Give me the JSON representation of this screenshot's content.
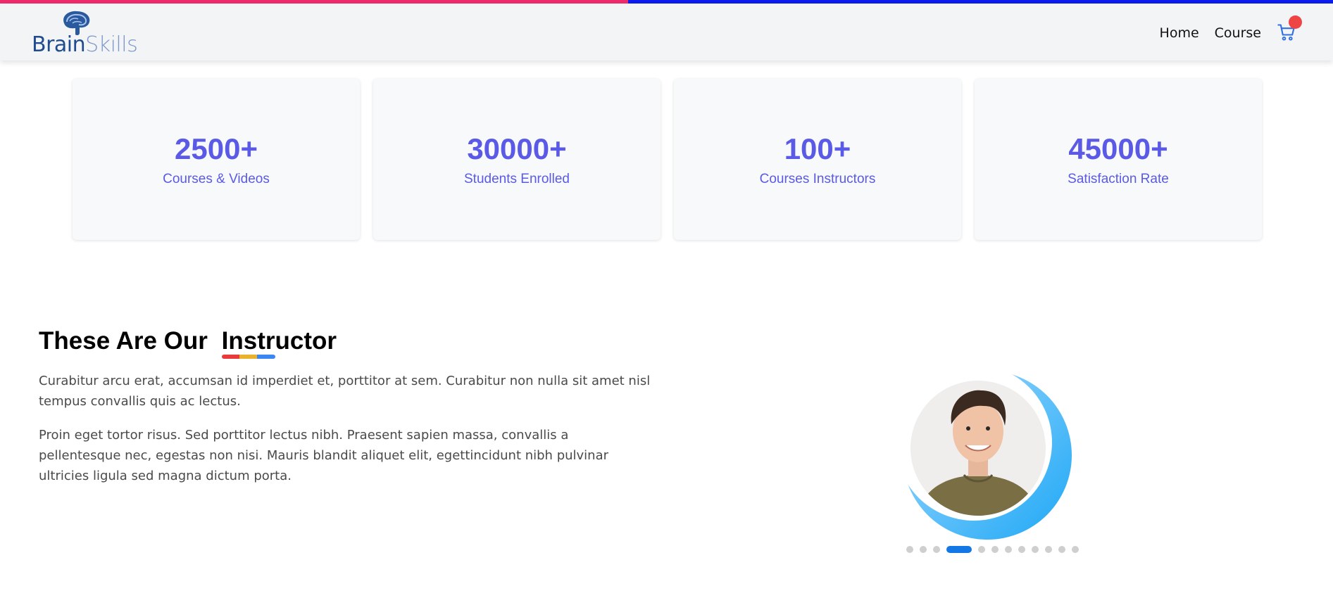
{
  "brand": {
    "name_part1": "Brain",
    "name_part2": "Skills"
  },
  "nav": {
    "items": [
      {
        "label": "Home"
      },
      {
        "label": "Course"
      }
    ]
  },
  "stats": [
    {
      "value": "2500+",
      "label": "Courses & Videos"
    },
    {
      "value": "30000+",
      "label": "Students Enrolled"
    },
    {
      "value": "100+",
      "label": "Courses Instructors"
    },
    {
      "value": "45000+",
      "label": "Satisfaction Rate"
    }
  ],
  "instructor": {
    "title_prefix": "These Are Our",
    "title_accent": "Instructor",
    "paragraph1": "Curabitur arcu erat, accumsan id imperdiet et, porttitor at sem. Curabitur non nulla sit amet nisl tempus convallis quis ac lectus.",
    "paragraph2": "Proin eget tortor risus. Sed porttitor lectus nibh. Praesent sapien massa, convallis a pellentesque nec, egestas non nisi. Mauris blandit aliquet elit, egettincidunt nibh pulvinar ultricies ligula sed magna dictum porta."
  },
  "carousel": {
    "count": 12,
    "active_index": 3
  },
  "colors": {
    "accent": "#5a5ae6",
    "topbar_left": "#ef2a6b",
    "topbar_right": "#0a1cf0",
    "cart_badge": "#ef4444",
    "carousel_active": "#1477e6"
  },
  "icons": {
    "cart": "cart-icon",
    "logo": "brain-icon"
  }
}
